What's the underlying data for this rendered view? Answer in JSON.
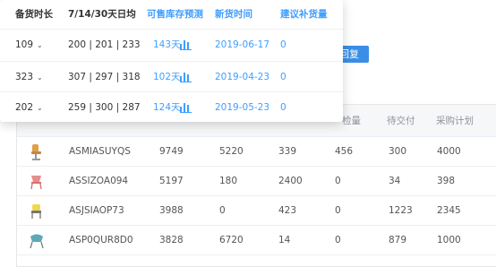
{
  "popover": {
    "headers": {
      "stock_duration": "备货时长",
      "daily_sales": "7/14/30天日均",
      "forecast": "可售库存预测",
      "new_stock_time": "新货时间",
      "suggest_qty": "建议补货量"
    },
    "rows": [
      {
        "duration": "109",
        "daily": "200 | 201 | 233",
        "forecast": "143天",
        "date": "2019-06-17",
        "qty": "0"
      },
      {
        "duration": "323",
        "daily": "307 | 297 | 318",
        "forecast": "102天",
        "date": "2019-04-23",
        "qty": "0"
      },
      {
        "duration": "202",
        "daily": "259 | 300 | 287",
        "forecast": "124天",
        "date": "2019-05-23",
        "qty": "0"
      }
    ]
  },
  "background": {
    "reply_button_label": "回复",
    "table_headers": {
      "inspect": "检量",
      "pending": "待交付",
      "plan": "采购计划"
    },
    "rows": [
      {
        "icon": "chair-icon",
        "sku": "ASMIASUYQS",
        "c1": "9749",
        "c2": "5220",
        "c3": "339",
        "c4": "456",
        "c5": "300",
        "c6": "4000"
      },
      {
        "icon": "chair-icon",
        "sku": "ASSIZOA094",
        "c1": "5197",
        "c2": "180",
        "c3": "2400",
        "c4": "0",
        "c5": "34",
        "c6": "398"
      },
      {
        "icon": "chair-icon",
        "sku": "ASJSIAOP73",
        "c1": "3988",
        "c2": "0",
        "c3": "423",
        "c4": "0",
        "c5": "1223",
        "c6": "2345"
      },
      {
        "icon": "chair-icon",
        "sku": "ASP0QUR8D0",
        "c1": "3828",
        "c2": "6720",
        "c3": "14",
        "c4": "0",
        "c5": "879",
        "c6": "1000"
      }
    ]
  },
  "colors": {
    "accent": "#409eff",
    "button": "#3a8ee6"
  }
}
